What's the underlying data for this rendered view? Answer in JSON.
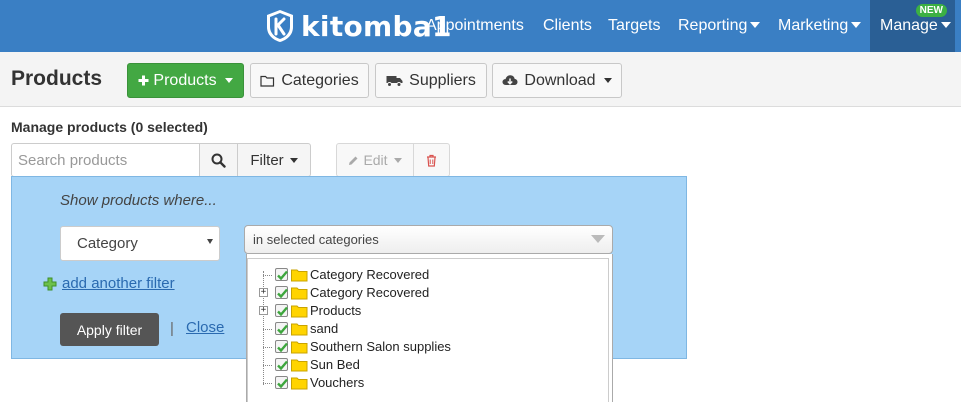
{
  "nav": {
    "brand": "kitomba1",
    "items": [
      {
        "label": "Appointments",
        "dropdown": false
      },
      {
        "label": "Clients",
        "dropdown": false
      },
      {
        "label": "Targets",
        "dropdown": false
      },
      {
        "label": "Reporting",
        "dropdown": true
      },
      {
        "label": "Marketing",
        "dropdown": true
      },
      {
        "label": "Manage",
        "dropdown": true,
        "badge": "NEW",
        "active": true
      }
    ]
  },
  "toolbar": {
    "title": "Products",
    "products_button": "Products",
    "categories_button": "Categories",
    "suppliers_button": "Suppliers",
    "download_button": "Download"
  },
  "manage": {
    "label": "Manage products (0 selected)",
    "search_placeholder": "Search products",
    "search_value": "",
    "filter_button": "Filter",
    "edit_button": "Edit"
  },
  "filter_panel": {
    "heading": "Show products where...",
    "field_select": "Category",
    "condition_select": "in selected categories",
    "add_filter_link": "add another filter",
    "apply_button": "Apply filter",
    "separator": "|",
    "close_link": "Close"
  },
  "category_tree": [
    {
      "label": "Category Recovered",
      "checked": true,
      "expandable": false
    },
    {
      "label": "Category Recovered",
      "checked": true,
      "expandable": true
    },
    {
      "label": "Products",
      "checked": true,
      "expandable": true
    },
    {
      "label": "sand",
      "checked": true,
      "expandable": false
    },
    {
      "label": "Southern Salon supplies",
      "checked": true,
      "expandable": false
    },
    {
      "label": "Sun Bed",
      "checked": true,
      "expandable": false
    },
    {
      "label": "Vouchers",
      "checked": true,
      "expandable": false
    }
  ],
  "colors": {
    "nav_bg": "#3a7fc4",
    "nav_active_bg": "#2a5f95",
    "primary_green": "#43a843",
    "panel_bg": "#a6d4f7",
    "link_blue": "#2a6ab0",
    "badge_green": "#3cb043"
  }
}
